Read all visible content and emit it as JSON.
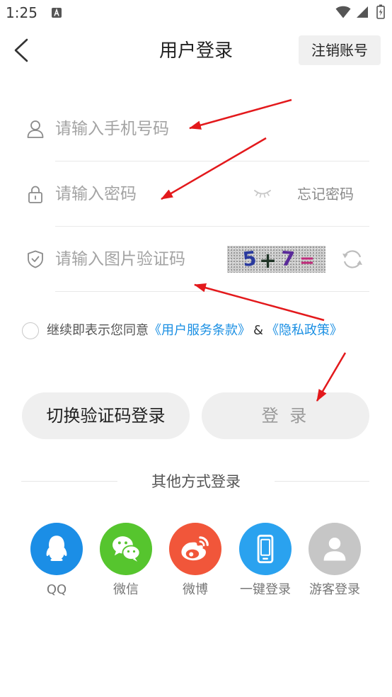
{
  "status_bar": {
    "time": "1:25",
    "notification_icon": "a-notification-icon",
    "wifi_icon": "wifi-icon",
    "signal_icon": "cell-signal-icon",
    "battery_icon": "battery-charging-icon"
  },
  "header": {
    "back_icon": "chevron-left-icon",
    "title": "用户登录",
    "deregister_label": "注销账号"
  },
  "form": {
    "phone": {
      "icon": "user-icon",
      "placeholder": "请输入手机号码"
    },
    "password": {
      "icon": "lock-icon",
      "placeholder": "请输入密码",
      "visibility_icon": "eye-closed-icon",
      "forgot_label": "忘记密码"
    },
    "captcha": {
      "icon": "shield-check-icon",
      "placeholder": "请输入图片验证码",
      "image_chars": [
        "5",
        "+",
        "7",
        "="
      ],
      "refresh_icon": "refresh-icon"
    }
  },
  "agreement": {
    "checked": false,
    "prefix": "继续即表示您同意",
    "terms_link": "《用户服务条款》",
    "separator": "&",
    "privacy_link": "《隐私政策》"
  },
  "actions": {
    "switch_label": "切换验证码登录",
    "login_label": "登 录",
    "login_enabled": false
  },
  "other_login": {
    "divider_label": "其他方式登录",
    "options": [
      {
        "label": "QQ",
        "icon": "qq-penguin-icon",
        "color": "#1b8ee6"
      },
      {
        "label": "微信",
        "icon": "wechat-icon",
        "color": "#56c52e"
      },
      {
        "label": "微博",
        "icon": "weibo-icon",
        "color": "#f1563a"
      },
      {
        "label": "一键登录",
        "icon": "mobile-phone-icon",
        "color": "#2aa2ef"
      },
      {
        "label": "游客登录",
        "icon": "guest-person-icon",
        "color": "#c6c6c6"
      }
    ]
  },
  "colors": {
    "link": "#1a8fe3",
    "annotation_arrow": "#e3191c",
    "button_bg": "#efefef"
  }
}
